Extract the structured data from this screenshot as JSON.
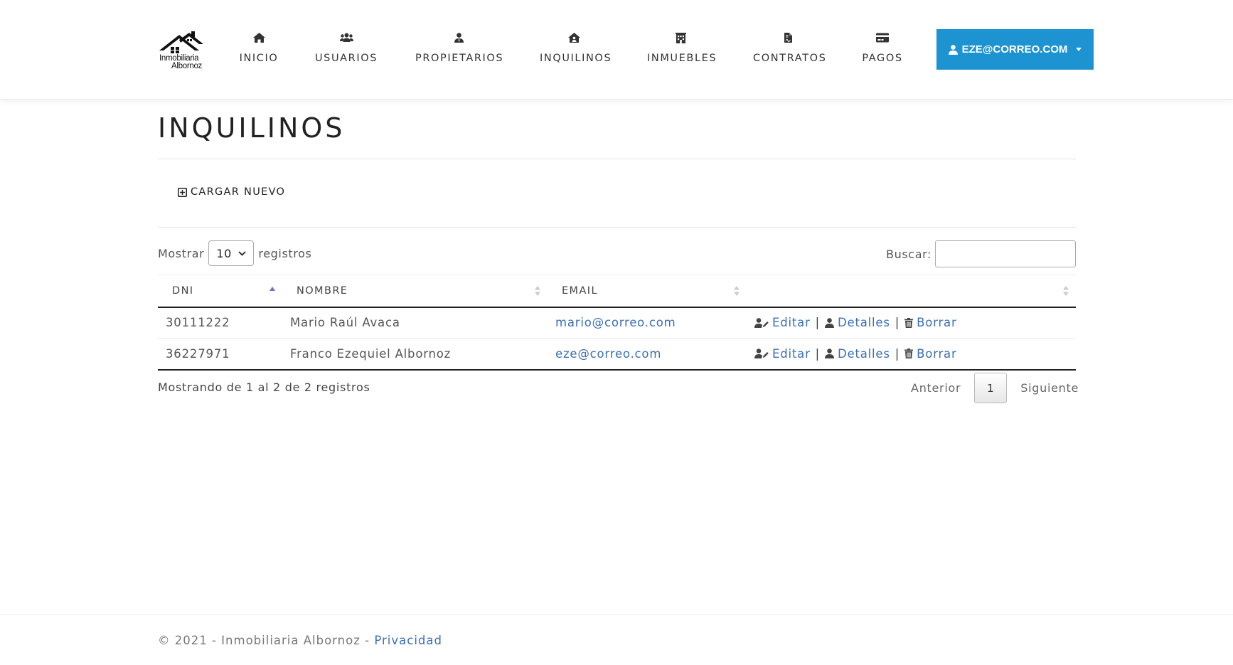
{
  "logo": {
    "line1": "Inmobiliaria",
    "line2": "Albornoz"
  },
  "nav": {
    "items": [
      {
        "label": "INICIO",
        "icon": "home-icon"
      },
      {
        "label": "USUARIOS",
        "icon": "users-icon"
      },
      {
        "label": "PROPIETARIOS",
        "icon": "user-tie-icon"
      },
      {
        "label": "INQUILINOS",
        "icon": "house-user-icon"
      },
      {
        "label": "INMUEBLES",
        "icon": "building-icon"
      },
      {
        "label": "CONTRATOS",
        "icon": "file-contract-icon"
      },
      {
        "label": "PAGOS",
        "icon": "credit-card-icon"
      }
    ],
    "user_label": "EZE@CORREO.COM",
    "accent": "#1d93d1"
  },
  "page": {
    "title": "INQUILINOS",
    "new_button": "CARGAR NUEVO"
  },
  "table_controls": {
    "show_prefix": "Mostrar",
    "show_value": "10",
    "show_suffix": "registros",
    "search_label": "Buscar:",
    "search_value": ""
  },
  "table": {
    "columns": [
      "DNI",
      "NOMBRE",
      "EMAIL",
      ""
    ],
    "rows": [
      {
        "dni": "30111222",
        "nombre": "Mario Raúl Avaca",
        "email": "mario@correo.com"
      },
      {
        "dni": "36227971",
        "nombre": "Franco Ezequiel Albornoz",
        "email": "eze@correo.com"
      }
    ],
    "actions": {
      "edit": "Editar",
      "details": "Detalles",
      "delete": "Borrar",
      "separator": "|"
    },
    "info": "Mostrando de 1 al 2 de 2 registros",
    "pagination": {
      "prev": "Anterior",
      "current": "1",
      "next": "Siguiente"
    }
  },
  "footer": {
    "text": "© 2021 - Inmobiliaria Albornoz -",
    "link": "Privacidad"
  }
}
